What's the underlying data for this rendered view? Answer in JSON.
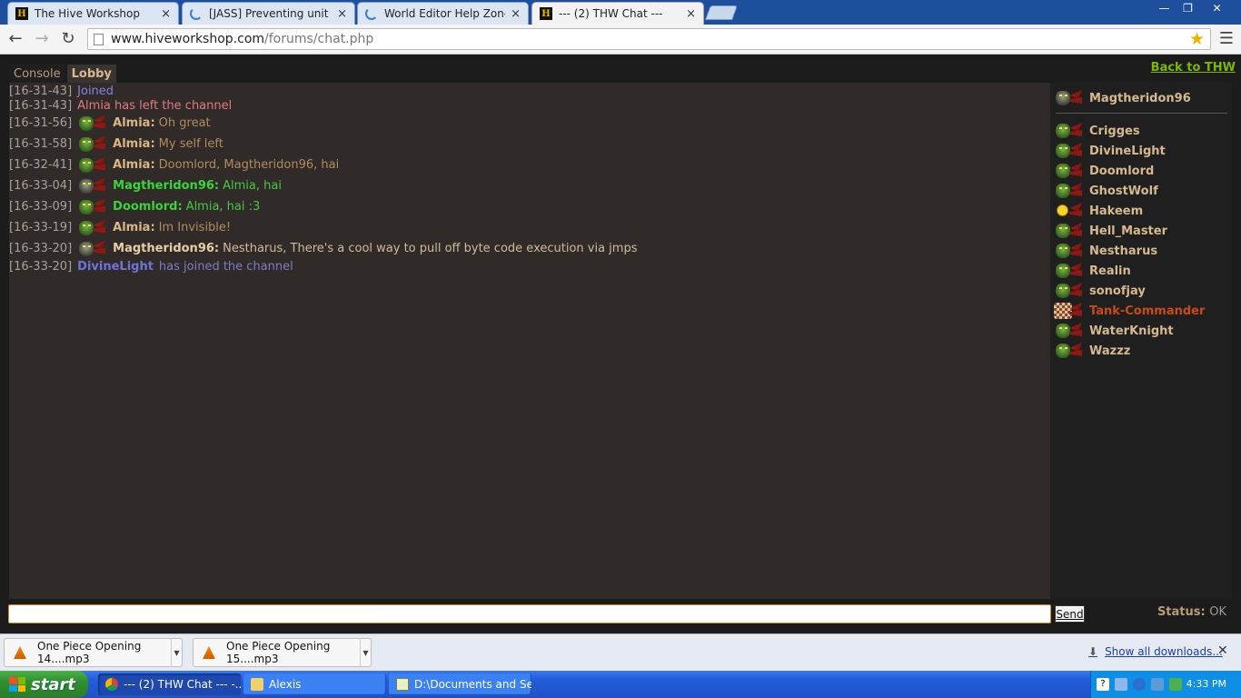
{
  "browser": {
    "tabs": [
      {
        "title": "The Hive Workshop",
        "icon": "hive-icon"
      },
      {
        "title": "[JASS] Preventing unit crash",
        "icon": "loading-icon"
      },
      {
        "title": "World Editor Help Zone - The",
        "icon": "loading-icon"
      },
      {
        "title": "--- (2) THW Chat ---",
        "icon": "hive-icon",
        "active": true
      }
    ],
    "url_host": "www.hiveworkshop.com",
    "url_path": "/forums/chat.php"
  },
  "chat": {
    "tabs": [
      "Console",
      "Lobby"
    ],
    "active_tab": "Lobby",
    "back_link": "Back to THW",
    "messages": [
      {
        "ts": "[16-31-43]",
        "type": "sys",
        "text": "Joined"
      },
      {
        "ts": "[16-31-43]",
        "type": "sys",
        "text": "Almia has left the channel"
      },
      {
        "ts": "[16-31-56]",
        "type": "user",
        "name": "Almia:",
        "text": "Oh great"
      },
      {
        "ts": "[16-31-58]",
        "type": "user",
        "name": "Almia:",
        "text": "My self left"
      },
      {
        "ts": "[16-32-41]",
        "type": "user",
        "name": "Almia:",
        "text": "Doomlord, Magtheridon96, hai"
      },
      {
        "ts": "[16-33-04]",
        "type": "user",
        "name": "Magtheridon96:",
        "text": "Almia, hai"
      },
      {
        "ts": "[16-33-09]",
        "type": "user",
        "name": "Doomlord:",
        "text": "Almia, hai :3"
      },
      {
        "ts": "[16-33-19]",
        "type": "user",
        "name": "Almia:",
        "text": "Im Invisible!"
      },
      {
        "ts": "[16-33-20]",
        "type": "user",
        "name": "Magtheridon96:",
        "text": "Nestharus, There's a cool way to pull off byte code execution via jmps"
      },
      {
        "ts": "[16-33-20]",
        "type": "sys",
        "name": "DivineLight",
        "text": "has joined the channel"
      }
    ],
    "current_user": "Magtheridon96",
    "users": [
      "Crigges",
      "DivineLight",
      "Doomlord",
      "GhostWolf",
      "Hakeem",
      "Hell_Master",
      "Nestharus",
      "Realin",
      "sonofjay",
      "Tank-Commander",
      "WaterKnight",
      "Wazzz"
    ],
    "input_value": "",
    "send_label": "Send",
    "status_label": "Status:",
    "status_value": "OK"
  },
  "downloads": {
    "items": [
      "One Piece Opening 14....mp3",
      "One Piece Opening 15....mp3"
    ],
    "show_all": "Show all downloads..."
  },
  "taskbar": {
    "start": "start",
    "tasks": [
      "--- (2) THW Chat --- -...",
      "Alexis",
      "D:\\Documents and Se..."
    ],
    "clock": "4:33 PM"
  }
}
